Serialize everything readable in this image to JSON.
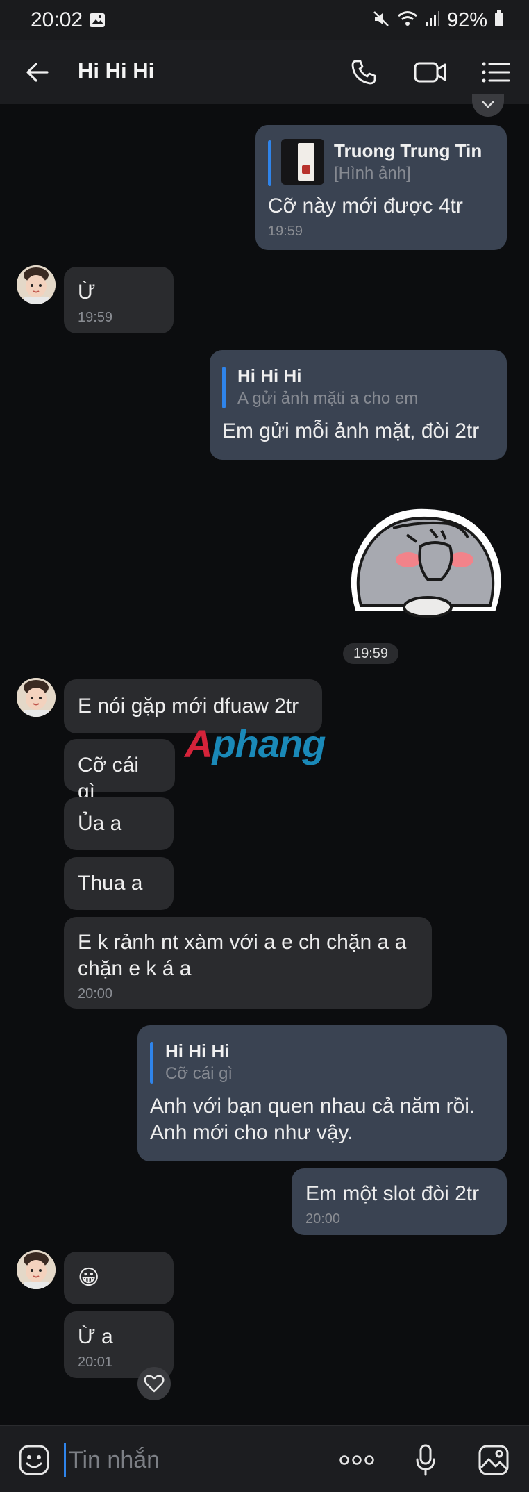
{
  "status_bar": {
    "time": "20:02",
    "battery": "92%"
  },
  "header": {
    "title": "Hi Hi Hi"
  },
  "messages": {
    "m1": {
      "quote_name": "Truong Trung Tin",
      "quote_text": "[Hình ảnh]",
      "text": "Cỡ này mới được 4tr",
      "time": "19:59"
    },
    "m2": {
      "text": "Ừ",
      "time": "19:59"
    },
    "m3": {
      "quote_name": "Hi Hi Hi",
      "quote_text": "A gửi ảnh mặti a cho em",
      "text": "Em gửi mỗi ảnh mặt, đòi 2tr"
    },
    "sticker_time": "19:59",
    "m4": {
      "text": "E nói gặp mới dfuaw 2tr"
    },
    "m5": {
      "text": "Cỡ cái gì"
    },
    "m6": {
      "text": "Ủa a"
    },
    "m7": {
      "text": "Thua a"
    },
    "m8": {
      "text": "E k rảnh nt xàm với a e ch chặn a a\nchặn e k á a",
      "time": "20:00"
    },
    "m9": {
      "quote_name": "Hi Hi Hi",
      "quote_text": "Cỡ cái gì",
      "text": "Anh với bạn quen nhau cả năm rồi.\nAnh mới cho như vậy."
    },
    "m10": {
      "text": "Em một slot đòi 2tr",
      "time": "20:00"
    },
    "m11": {
      "text": "😀"
    },
    "m12": {
      "text": "Ừ a",
      "time": "20:01"
    }
  },
  "watermark": {
    "part1": "A",
    "part2": "phang"
  },
  "input": {
    "placeholder": "Tin nhắn"
  }
}
